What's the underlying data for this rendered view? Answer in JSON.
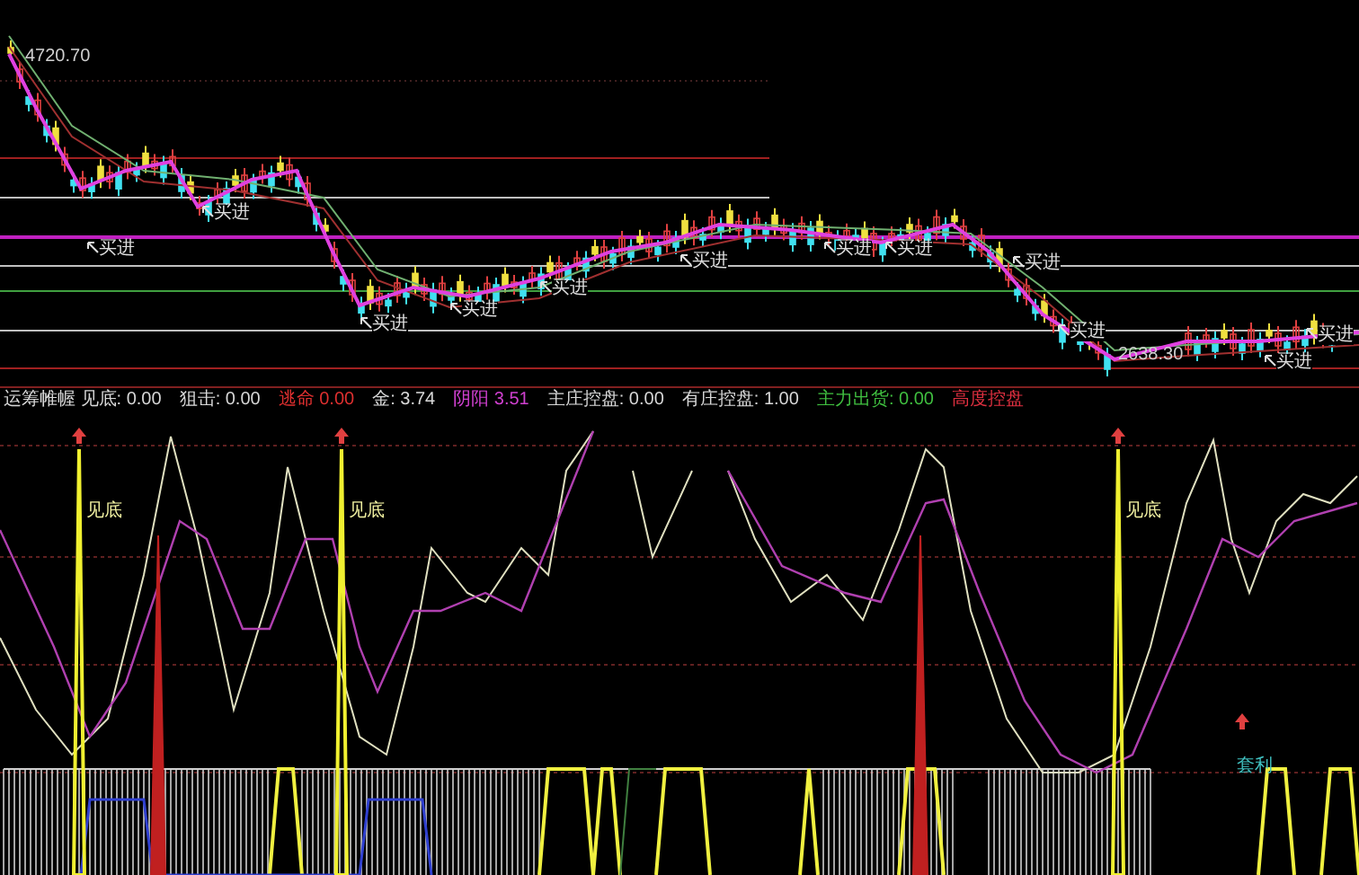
{
  "price_chart": {
    "high_label": "4720.70",
    "low_label": "2638.30",
    "signals": [
      {
        "text": "买进"
      },
      {
        "text": "买进"
      },
      {
        "text": "买进"
      },
      {
        "text": "买进"
      },
      {
        "text": "买进"
      },
      {
        "text": "买进"
      },
      {
        "text": "买进"
      },
      {
        "text": "买进"
      },
      {
        "text": "买进"
      },
      {
        "text": "买进"
      },
      {
        "text": "买进"
      },
      {
        "text": "买进"
      }
    ]
  },
  "indicator_strip": [
    {
      "text": "运筹帷幄 见底: 0.00",
      "color": "#d8d8d8"
    },
    {
      "text": "狙击: 0.00",
      "color": "#d8d8d8"
    },
    {
      "text": "逃命 0.00",
      "color": "#e03030"
    },
    {
      "text": "金: 3.74",
      "color": "#d8d8d8"
    },
    {
      "text": "阴阳 3.51",
      "color": "#d040d0"
    },
    {
      "text": "主庄控盘: 0.00",
      "color": "#d8d8d8"
    },
    {
      "text": "有庄控盘: 1.00",
      "color": "#d8d8d8"
    },
    {
      "text": "主力出货: 0.00",
      "color": "#40c040"
    },
    {
      "text": "高度控盘",
      "color": "#e03040"
    }
  ],
  "oscillator": {
    "signals": [
      {
        "kind": "bottom",
        "text": "见底"
      },
      {
        "kind": "bottom",
        "text": "见底"
      },
      {
        "kind": "bottom",
        "text": "见底"
      },
      {
        "kind": "arbitrage",
        "text": "套利"
      }
    ]
  }
}
